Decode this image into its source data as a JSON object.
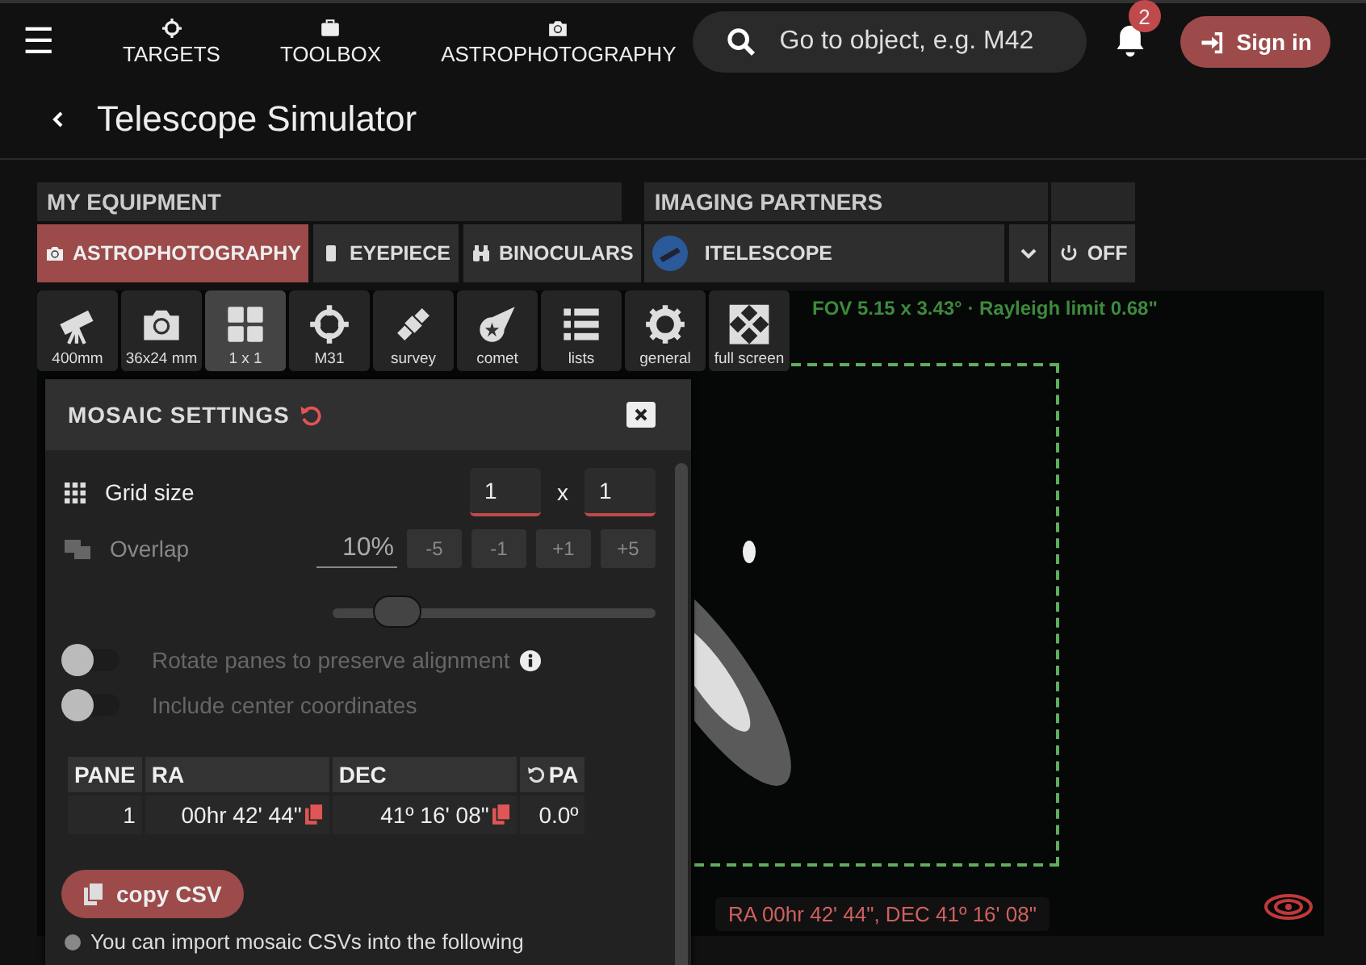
{
  "nav": {
    "menu_icon": "☰",
    "items": [
      {
        "label": "TARGETS",
        "kind": "crosshair"
      },
      {
        "label": "TOOLBOX",
        "kind": "toolbox"
      },
      {
        "label": "ASTROPHOTOGRAPHY",
        "kind": "camera"
      }
    ],
    "search": {
      "placeholder": "Go to object, e.g. M42"
    },
    "notifications": "2",
    "sign_in": "Sign in"
  },
  "page_title": "Telescope Simulator",
  "equipment": {
    "header": "MY EQUIPMENT",
    "tabs": [
      {
        "label": "ASTROPHOTOGRAPHY",
        "kind": "camera",
        "selected": true
      },
      {
        "label": "EYEPIECE",
        "kind": "eyepiece",
        "selected": false
      },
      {
        "label": "BINOCULARS",
        "kind": "binoculars",
        "selected": false
      }
    ],
    "partners_header": "IMAGING PARTNERS",
    "partner": "ITELESCOPE",
    "off": "OFF"
  },
  "tools": [
    {
      "label": "400mm",
      "kind": "telescope",
      "selected": false
    },
    {
      "label": "36x24 mm",
      "kind": "camera",
      "selected": false
    },
    {
      "label": "1 x 1",
      "kind": "grid",
      "selected": true
    },
    {
      "label": "M31",
      "kind": "crosshair",
      "selected": false
    },
    {
      "label": "survey",
      "kind": "satellite",
      "selected": false
    },
    {
      "label": "comet",
      "kind": "comet",
      "selected": false
    },
    {
      "label": "lists",
      "kind": "list",
      "selected": false
    },
    {
      "label": "general",
      "kind": "gear",
      "selected": false
    },
    {
      "label": "full screen",
      "kind": "expand",
      "selected": false
    }
  ],
  "fov": "FOV 5.15 x 3.43° · Rayleigh limit 0.68\"",
  "mosaic": {
    "title": "MOSAIC SETTINGS",
    "grid_label": "Grid size",
    "grid_cols": "1",
    "grid_x": "x",
    "grid_rows": "1",
    "overlap_label": "Overlap",
    "overlap_value": "10%",
    "steps": [
      "-5",
      "-1",
      "+1",
      "+5"
    ],
    "overlap_slider": {
      "level": 0.15
    },
    "toggles": [
      {
        "label": "Rotate panes to preserve alignment",
        "on": false,
        "info": true
      },
      {
        "label": "Include center coordinates",
        "on": false,
        "info": false
      }
    ],
    "table": {
      "columns": [
        "PANE",
        "RA",
        "DEC",
        "PA"
      ],
      "rows": [
        [
          "1",
          "00hr 42' 44\"",
          "41º 16' 08\"",
          "0.0º"
        ]
      ]
    },
    "copy_csv": "copy CSV",
    "note": "You can import mosaic CSVs into the following"
  },
  "sky_status": "RA 00hr 42' 44\", DEC 41º 16' 08\""
}
